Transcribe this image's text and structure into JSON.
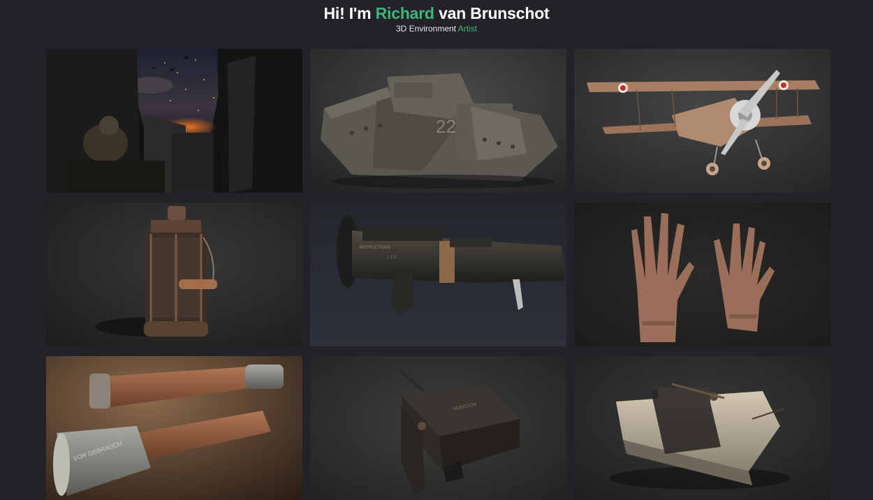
{
  "header": {
    "greeting": "Hi! I'm",
    "first_name": "Richard",
    "last_name": "van Brunschot",
    "role_prefix": "3D Environment",
    "role_accent": "Artist"
  },
  "colors": {
    "background": "#232228",
    "accent": "#3fb57e",
    "text": "#ffffff"
  },
  "portfolio": {
    "items": [
      {
        "subject": "trench-night-scene"
      },
      {
        "subject": "ww1-tank"
      },
      {
        "subject": "biplane"
      },
      {
        "subject": "lantern"
      },
      {
        "subject": "rocket-launcher"
      },
      {
        "subject": "leather-gloves"
      },
      {
        "subject": "stick-grenades"
      },
      {
        "subject": "field-telephone-box"
      },
      {
        "subject": "explosive-charge"
      }
    ]
  }
}
